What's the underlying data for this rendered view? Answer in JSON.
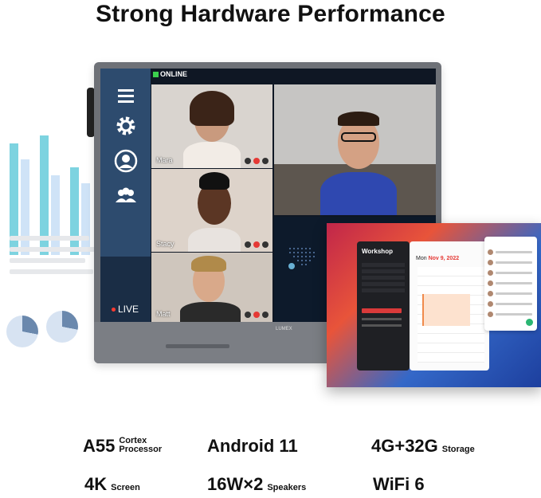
{
  "headline": "Strong Hardware Performance",
  "screen": {
    "online_label": "ONLINE",
    "live_label": "LIVE",
    "brand_text": "LUMEX",
    "nav_icons": [
      "menu-icon",
      "gear-icon",
      "user-icon",
      "group-icon"
    ],
    "participants": [
      {
        "name": "Mara"
      },
      {
        "name": "Stacy"
      },
      {
        "name": "Matt"
      }
    ]
  },
  "overlay": {
    "app_title": "Workshop",
    "calendar_date_month": "Mon",
    "calendar_date_day": "Nov 9, 2022"
  },
  "specs": [
    {
      "big": "A55",
      "small_line1": "Cortex",
      "small_line2": "Processor"
    },
    {
      "big": "Android 11",
      "small_line1": "",
      "small_line2": ""
    },
    {
      "big": "4G+32G",
      "small_line1": "",
      "small_line2": "Storage"
    },
    {
      "big": "4K",
      "small_line1": "",
      "small_line2": "Screen"
    },
    {
      "big": "16W×2",
      "small_line1": "",
      "small_line2": "Speakers"
    },
    {
      "big": "WiFi 6",
      "small_line1": "",
      "small_line2": ""
    }
  ],
  "colors": {
    "nav_bg": "#2d4b6e",
    "online_green": "#3ccf4e",
    "live_red": "#ff3b30"
  }
}
